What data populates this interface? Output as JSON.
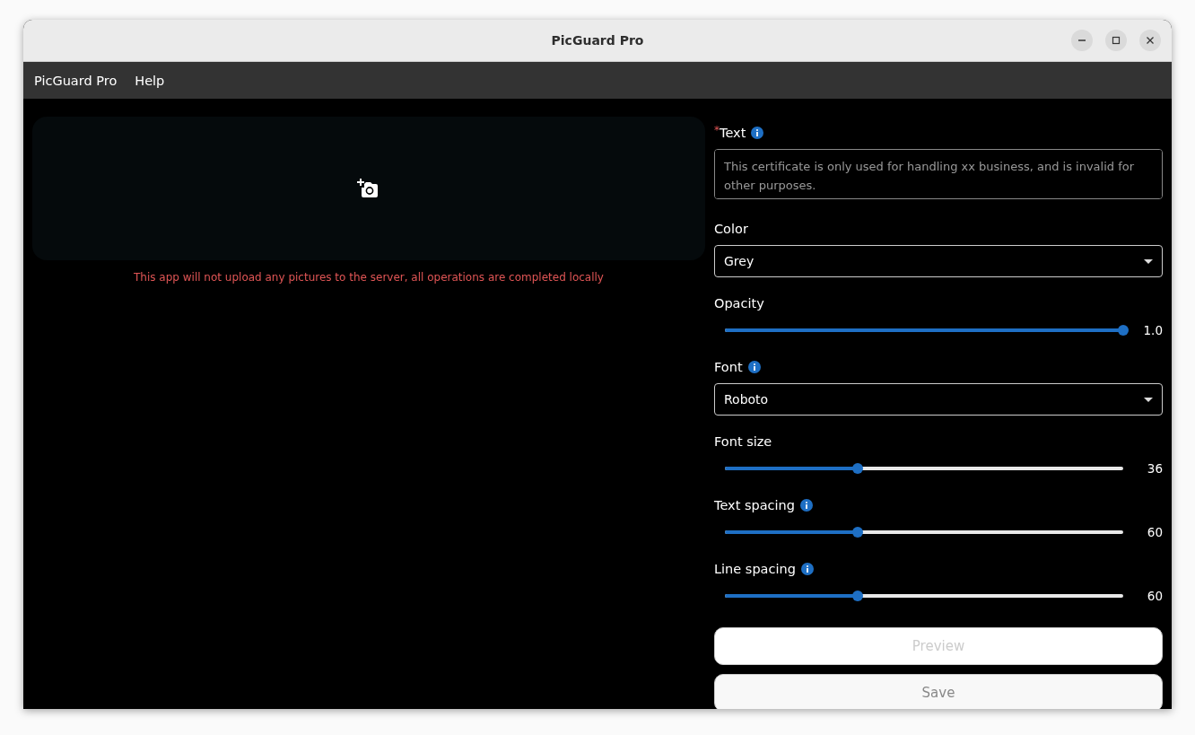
{
  "window": {
    "title": "PicGuard Pro"
  },
  "menu": [
    {
      "label": "PicGuard Pro"
    },
    {
      "label": "Help"
    }
  ],
  "upload": {
    "notice": "This app will not upload any pictures to the server, all operations are completed locally"
  },
  "fields": [
    {
      "kind": "textarea",
      "label": "Text",
      "required_mark": "*",
      "info": true,
      "placeholder": "This certificate is only used for handling xx business, and is invalid for other purposes."
    },
    {
      "kind": "select",
      "label": "Color",
      "info": false,
      "value": "Grey"
    },
    {
      "kind": "slider",
      "label": "Opacity",
      "info": false,
      "level": 1.0,
      "reading": "1.0"
    },
    {
      "kind": "select",
      "label": "Font",
      "info": true,
      "value": "Roboto"
    },
    {
      "kind": "slider",
      "label": "Font size",
      "info": false,
      "level": 0.333,
      "reading": "36"
    },
    {
      "kind": "slider",
      "label": "Text spacing",
      "info": true,
      "level": 0.333,
      "reading": "60"
    },
    {
      "kind": "slider",
      "label": "Line spacing",
      "info": true,
      "level": 0.333,
      "reading": "60"
    }
  ],
  "buttons": [
    {
      "label": "Preview",
      "disabled": true
    },
    {
      "label": "Save",
      "disabled": false
    }
  ]
}
